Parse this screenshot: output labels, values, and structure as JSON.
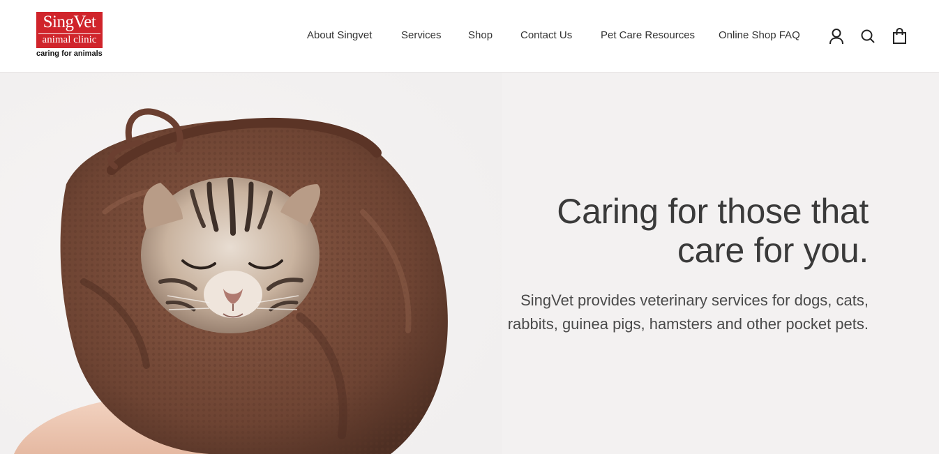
{
  "brand": {
    "name": "SingVet",
    "subtitle": "animal clinic",
    "tagline": "caring for animals",
    "colors": {
      "logo_red": "#d0242b",
      "text": "#333333",
      "hero_bg": "#f3f1f1"
    }
  },
  "nav": {
    "items": [
      {
        "label": "About Singvet"
      },
      {
        "label": "Services"
      },
      {
        "label": "Shop"
      },
      {
        "label": "Contact Us"
      },
      {
        "label": "Pet Care Resources"
      },
      {
        "label": "Online Shop FAQ"
      }
    ],
    "icons": [
      "account-icon",
      "search-icon",
      "cart-icon"
    ]
  },
  "hero": {
    "title_line1": "Caring for those that",
    "title_line2": "care for you.",
    "text_line1": "SingVet provides veterinary services for dogs, cats,",
    "text_line2": "rabbits, guinea pigs, hamsters and other pocket pets.",
    "image_subject": "kitten wrapped in brown towel held in hand"
  }
}
